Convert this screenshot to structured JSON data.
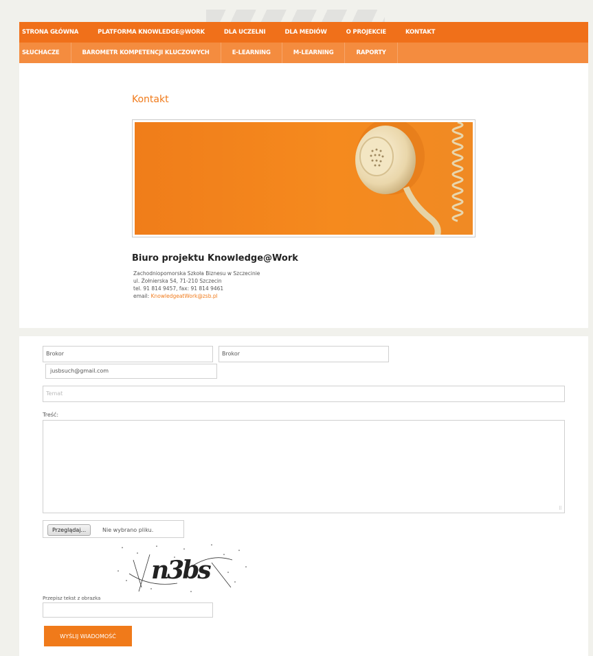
{
  "nav": {
    "main": [
      "STRONA GŁÓWNA",
      "PLATFORMA KNOWLEDGE@WORK",
      "DLA UCZELNI",
      "DLA MEDIÓW",
      "O PROJEKCIE",
      "KONTAKT"
    ],
    "sub": [
      "SŁUCHACZE",
      "BAROMETR KOMPETENCJI KLUCZOWYCH",
      "E-LEARNING",
      "M-LEARNING",
      "RAPORTY"
    ]
  },
  "page": {
    "title": "Kontakt",
    "office_title": "Biuro projektu Knowledge@Work",
    "address": {
      "line1": "Zachodniopomorska Szkoła Biznesu w Szczecinie",
      "line2": "ul. Żołnierska 54, 71-210 Szczecin",
      "line3": "tel. 91 814 9457, fax: 91 814 9461",
      "email_label": "email: ",
      "email": "KnowledgeatWork@zsb.pl"
    }
  },
  "form": {
    "first_name_value": "Brokor",
    "last_name_value": "Brokor",
    "email_value": "jusbsuch@gmail.com",
    "subject_placeholder": "Temat",
    "content_label": "Treść:",
    "file_button": "Przeglądaj...",
    "file_status": "Nie wybrano pliku.",
    "captcha_text": "n3bs",
    "captcha_label": "Przepisz tekst z obrazka",
    "submit_label": "WYŚLIJ WIADOMOŚĆ"
  },
  "colors": {
    "accent": "#f07a1a",
    "nav_main": "#f0701a",
    "nav_sub": "#f48c3f"
  }
}
